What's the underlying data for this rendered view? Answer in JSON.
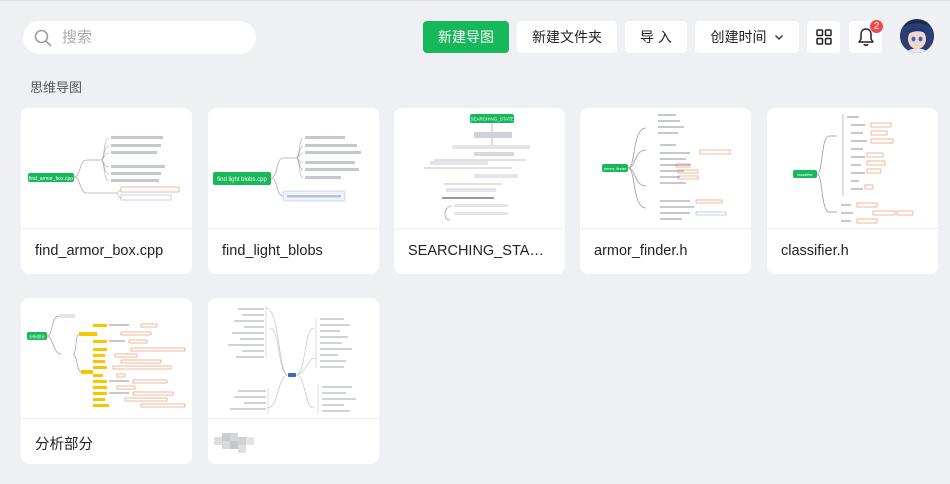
{
  "search": {
    "placeholder": "搜索",
    "value": ""
  },
  "toolbar": {
    "new_map_label": "新建导图",
    "new_folder_label": "新建文件夹",
    "import_label": "导 入",
    "sort_label": "创建时间",
    "notification_count": "2"
  },
  "section": {
    "title": "思维导图"
  },
  "cards": [
    {
      "title": "find_armor_box.cpp",
      "thumb_root": "find_armor_box.cpp"
    },
    {
      "title": "find_light_blobs",
      "thumb_root": "find light blobs.cpp"
    },
    {
      "title": "SEARCHING_STA…",
      "thumb_root": "SEARCHING_STATE"
    },
    {
      "title": "armor_finder.h",
      "thumb_root": "armor_finder"
    },
    {
      "title": "classifier.h",
      "thumb_root": "classifier"
    },
    {
      "title": "分析部分",
      "thumb_root": "分析部分"
    },
    {
      "title": ""
    }
  ],
  "colors": {
    "accent": "#16b85a",
    "badge": "#f04a4a",
    "highlight": "#f7c600",
    "annotation": "#e8703a"
  }
}
